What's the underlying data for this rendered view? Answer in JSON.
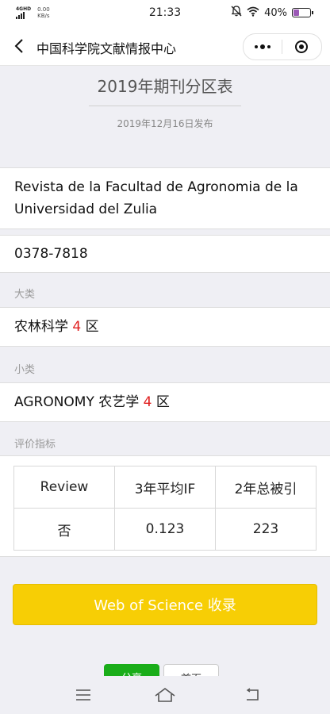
{
  "status_bar": {
    "network": "4GHD",
    "speed": "0.00",
    "speed_unit": "KB/s",
    "time": "21:33",
    "battery_text": "40%",
    "battery_level": 0.4
  },
  "nav": {
    "title": "中国科学院文献情报中心"
  },
  "header": {
    "title": "2019年期刊分区表",
    "publish_date": "2019年12月16日发布"
  },
  "journal": {
    "name": "Revista de la Facultad de Agronomia de la Universidad del Zulia",
    "issn": "0378-7818"
  },
  "major_category": {
    "label": "大类",
    "name": "农林科学",
    "zone": "4",
    "zone_suffix": "区"
  },
  "minor_category": {
    "label": "小类",
    "name": "AGRONOMY 农艺学",
    "zone": "4",
    "zone_suffix": "区"
  },
  "metrics": {
    "label": "评价指标",
    "headers": [
      "Review",
      "3年平均IF",
      "2年总被引"
    ],
    "values": [
      "否",
      "0.123",
      "223"
    ]
  },
  "actions": {
    "wos_label": "Web of Science 收录",
    "share_label": "分享",
    "home_label": "首页"
  },
  "colors": {
    "accent_yellow": "#f7ce05",
    "zone_red": "#e02020",
    "share_green": "#1aad19"
  }
}
